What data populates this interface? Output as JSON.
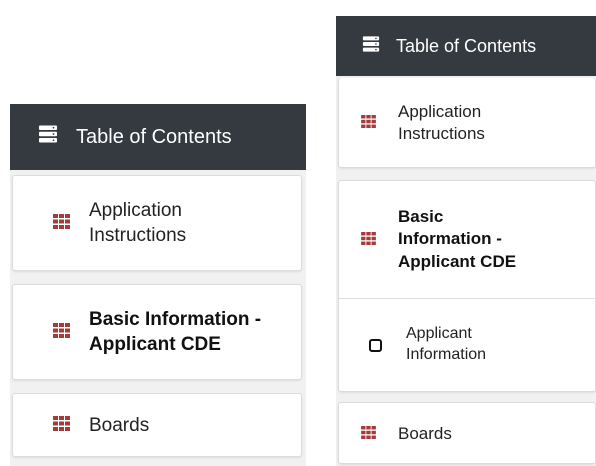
{
  "colors": {
    "header_bg": "#343a40",
    "header_text": "#ffffff",
    "grid_icon": "#a33b3b",
    "panel_bg": "#f1f1f1"
  },
  "left": {
    "header": {
      "title": "Table of Contents",
      "icon": "server-stack-icon"
    },
    "items": [
      {
        "label": "Application Instructions",
        "icon": "grid-icon"
      },
      {
        "label": "Basic Information - Applicant CDE",
        "icon": "grid-icon"
      },
      {
        "label": "Boards",
        "icon": "grid-icon"
      }
    ]
  },
  "right": {
    "header": {
      "title": "Table of Contents",
      "icon": "server-stack-icon"
    },
    "items": [
      {
        "label": "Application Instructions",
        "icon": "grid-icon"
      },
      {
        "label": "Basic Information - Applicant CDE",
        "icon": "grid-icon"
      },
      {
        "label": "Applicant Information",
        "icon": "square-outline-icon"
      },
      {
        "label": "Boards",
        "icon": "grid-icon"
      }
    ]
  }
}
